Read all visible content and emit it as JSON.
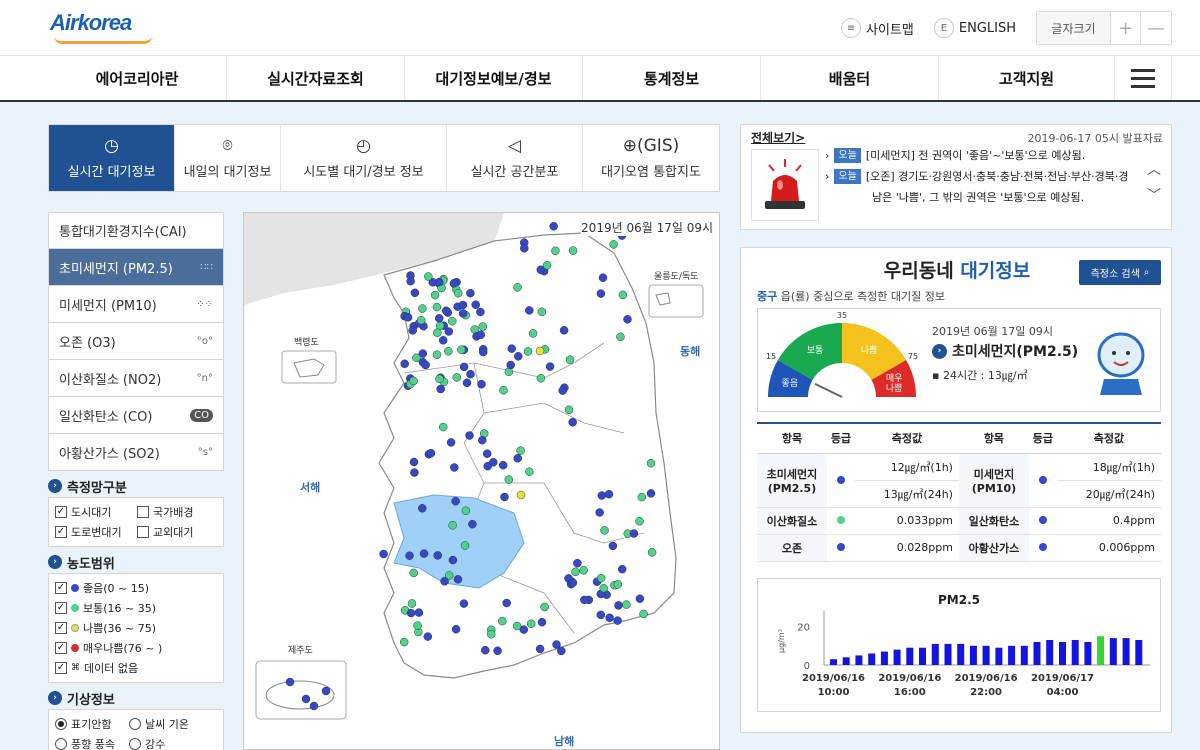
{
  "logo": {
    "part1": "Air",
    "part2": "korea"
  },
  "toplinks": {
    "sitemap": "사이트맵",
    "english": "ENGLISH",
    "fontsize": "글자크기",
    "plus": "+",
    "minus": "—"
  },
  "gnb": [
    "에어코리아란",
    "실시간자료조회",
    "대기정보예보/경보",
    "통계정보",
    "배움터",
    "고객지원"
  ],
  "tabs": [
    {
      "label": "실시간 대기정보",
      "icon": "clock-icon",
      "glyph": "◷"
    },
    {
      "label": "내일의 대기정보",
      "icon": "location-icon",
      "glyph": "⌾"
    },
    {
      "label": "시도별 대기/경보 정보",
      "icon": "compass-icon",
      "glyph": "◴"
    },
    {
      "label": "실시간 공간분포",
      "icon": "megaphone-icon",
      "glyph": "◁"
    },
    {
      "label": "대기오염 통합지도",
      "icon": "globe-icon",
      "glyph": "⊕(GIS)"
    }
  ],
  "pollutants": [
    {
      "label": "통합대기환경지수(CAI)",
      "icon": ""
    },
    {
      "label": "초미세먼지 (PM2.5)",
      "icon": "∷∷"
    },
    {
      "label": "미세먼지 (PM10)",
      "icon": "⁘⁘"
    },
    {
      "label": "오존 (O3)",
      "icon": "°o°"
    },
    {
      "label": "이산화질소 (NO2)",
      "icon": "°n°"
    },
    {
      "label": "일산화탄소 (CO)",
      "icon": "CO"
    },
    {
      "label": "아황산가스 (SO2)",
      "icon": "°s°"
    }
  ],
  "network": {
    "title": "측정망구분",
    "items": [
      {
        "label": "도시대기",
        "checked": true
      },
      {
        "label": "국가배경",
        "checked": false
      },
      {
        "label": "도로변대기",
        "checked": true
      },
      {
        "label": "교외대기",
        "checked": false
      }
    ]
  },
  "range": {
    "title": "농도범위",
    "items": [
      {
        "label": "좋음(0 ~ 15)",
        "color": "#3548c8"
      },
      {
        "label": "보통(16 ~ 35)",
        "color": "#4fd38a"
      },
      {
        "label": "나쁨(36 ~ 75)",
        "color": "#e9e040"
      },
      {
        "label": "매우나쁨(76 ~ )",
        "color": "#d62b2b"
      },
      {
        "label": "데이터 없음",
        "color": ""
      }
    ]
  },
  "weather": {
    "title": "기상정보",
    "items": [
      {
        "label": "표기안함",
        "on": true
      },
      {
        "label": "날씨 기온",
        "on": false
      },
      {
        "label": "풍향 풍속",
        "on": false
      },
      {
        "label": "강수",
        "on": false
      }
    ]
  },
  "map": {
    "date": "2019년 06월 17일 09시",
    "labels": {
      "ulleung": "울릉도/독도",
      "baengnyeong": "백령도",
      "east": "동해",
      "west": "서해",
      "south": "남해",
      "jeju": "제주도"
    }
  },
  "notice": {
    "title": "전체보기>",
    "published": "2019-06-17 05시 발표자료",
    "items": [
      {
        "tag": "오늘",
        "text": "[미세먼지] 전 권역이 '좋음'~'보통'으로 예상됨."
      },
      {
        "tag": "오늘",
        "text": "[오존] 경기도·강원영서·충북·충남·전북·전남·부산·경북·경"
      },
      {
        "tag": "",
        "text": "남은 '나쁨', 그 밖의 권역은 '보통'으로 예상됨."
      }
    ]
  },
  "local": {
    "title1": "우리동네",
    "title2": "대기정보",
    "search": "측정소 검색",
    "district": "중구",
    "subtitle": "읍(률) 중심으로 측정한 대기질 정보",
    "gauge": {
      "date": "2019년 06월 17일 09시",
      "name": "초미세먼지(PM2.5)",
      "value": "▪ 24시간 : 13㎍/㎥",
      "bands": [
        {
          "label": "좋음",
          "color": "#1f55b8"
        },
        {
          "label": "보통",
          "color": "#1aa850"
        },
        {
          "label": "나쁨",
          "color": "#f3c21d"
        },
        {
          "label": "매우\n나쁨",
          "color": "#e02a2a"
        }
      ],
      "ticks": [
        "15",
        "35",
        "75"
      ],
      "level": 13
    }
  },
  "measure": {
    "headers": [
      "항목",
      "등급",
      "측정값",
      "항목",
      "등급",
      "측정값"
    ],
    "rows": [
      {
        "n1": "초미세먼지\n(PM2.5)",
        "c1": "#3548c8",
        "v1a": "12㎍/㎥(1h)",
        "v1b": "13㎍/㎥(24h)",
        "n2": "미세먼지\n(PM10)",
        "c2": "#3548c8",
        "v2a": "18㎍/㎥(1h)",
        "v2b": "20㎍/㎥(24h)"
      },
      {
        "n1": "이산화질소",
        "c1": "#4fd38a",
        "v1a": "0.033ppm",
        "n2": "일산화탄소",
        "c2": "#3548c8",
        "v2a": "0.4ppm"
      },
      {
        "n1": "오존",
        "c1": "#3548c8",
        "v1a": "0.028ppm",
        "n2": "아황산가스",
        "c2": "#3548c8",
        "v2a": "0.006ppm"
      }
    ]
  },
  "chart_data": {
    "type": "bar",
    "title": "PM2.5",
    "ylabel": "μg/m³",
    "ylim": [
      0,
      25
    ],
    "yticks": [
      0,
      20
    ],
    "x_tick_labels": [
      "2019/06/16\n10:00",
      "2019/06/16\n16:00",
      "2019/06/16\n22:00",
      "2019/06/17\n04:00"
    ],
    "values": [
      3,
      4,
      5,
      6,
      7,
      8,
      9,
      9,
      11,
      11,
      11,
      10,
      10,
      9,
      10,
      10,
      12,
      13,
      12,
      13,
      12,
      15,
      14,
      14,
      13
    ],
    "highlight_index": 21,
    "bar_color": "#1414e0",
    "highlight_color": "#33d633"
  }
}
